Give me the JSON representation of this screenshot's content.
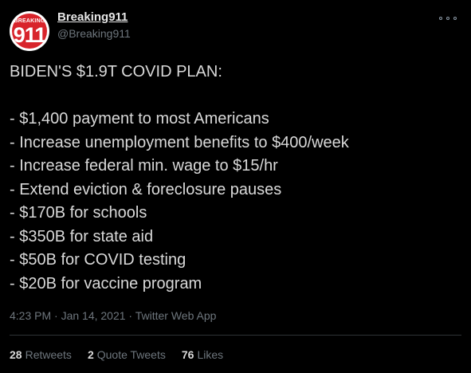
{
  "author": {
    "display_name": "Breaking911",
    "handle": "@Breaking911",
    "avatar_text_top": "BREAKING",
    "avatar_text_big": "911"
  },
  "tweet": {
    "heading": "BIDEN'S $1.9T COVID PLAN:",
    "items": [
      "- $1,400 payment to most Americans",
      "- Increase unemployment benefits to $400/week",
      "- Increase federal min. wage to $15/hr",
      "- Extend eviction & foreclosure pauses",
      "- $170B for schools",
      "- $350B for state aid",
      "- $50B for COVID testing",
      "- $20B for vaccine program"
    ],
    "timestamp": "4:23 PM · Jan 14, 2021 · Twitter Web App"
  },
  "stats": {
    "retweets_count": "28",
    "retweets_label": "Retweets",
    "quote_count": "2",
    "quote_label": "Quote Tweets",
    "likes_count": "76",
    "likes_label": "Likes"
  },
  "colors": {
    "background": "#000000",
    "text": "#d9d9d9",
    "secondary": "#6e767d",
    "avatar_red": "#d8242b"
  },
  "icons": {
    "more": "more-horizontal-icon"
  }
}
